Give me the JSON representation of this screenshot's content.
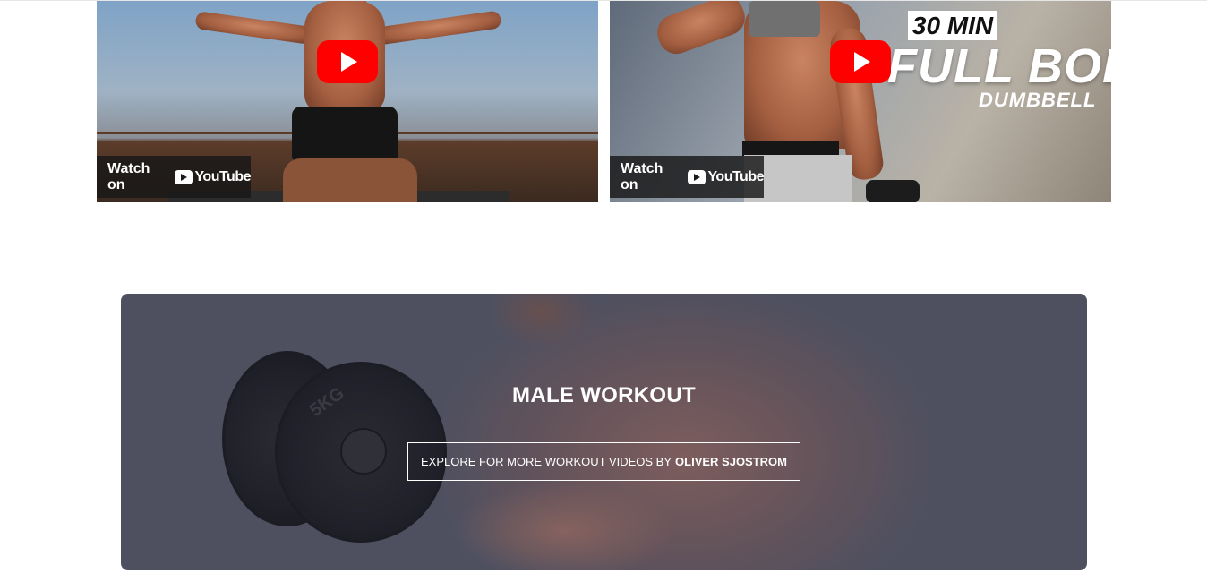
{
  "videos": [
    {
      "id": "video-1",
      "thumbnail_text": "",
      "watch_label": "Watch on",
      "provider": "YouTube"
    },
    {
      "id": "video-2",
      "badge": "30 MIN",
      "headline": "FULL BODY",
      "subheadline": "DUMBBELL",
      "watch_label": "Watch on",
      "provider": "YouTube"
    }
  ],
  "banner": {
    "title": "MALE WORKOUT",
    "button_prefix": "EXPLORE FOR MORE WORKOUT VIDEOS BY",
    "button_author": "OLIVER SJOSTROM",
    "plate_label": "5KG",
    "overlay_color": "#4e5060"
  },
  "colors": {
    "youtube_red": "#ff0000",
    "watch_bar": "#171717"
  },
  "icons": {
    "play": "play-icon",
    "youtube": "youtube-logo-icon"
  }
}
